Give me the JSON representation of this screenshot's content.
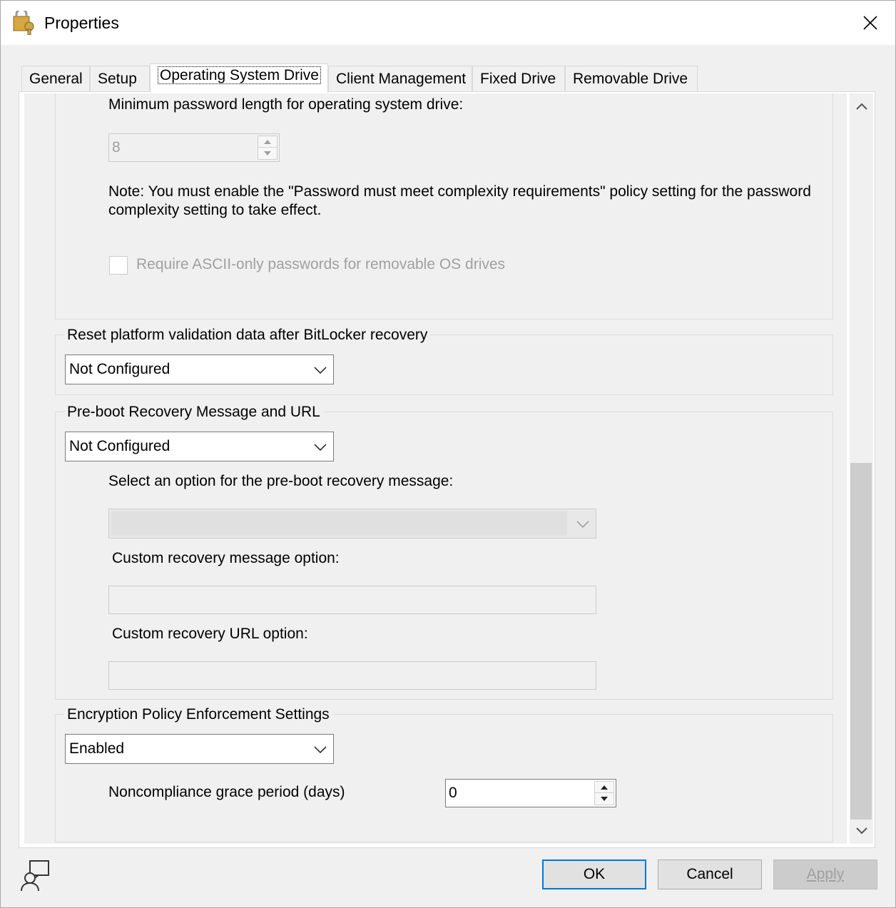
{
  "window": {
    "title": "Properties",
    "app_icon": "key-padlock-icon",
    "close_icon": "close-icon"
  },
  "tabs": [
    {
      "label": "General"
    },
    {
      "label": "Setup"
    },
    {
      "label": "Operating System Drive"
    },
    {
      "label": "Client Management"
    },
    {
      "label": "Fixed Drive"
    },
    {
      "label": "Removable Drive"
    }
  ],
  "active_tab": "Operating System Drive",
  "password_section": {
    "min_length_label": "Minimum password length for operating system drive:",
    "min_length_value": "8",
    "note": "Note: You must enable the \"Password must meet complexity requirements\" policy setting for the password complexity setting to take effect.",
    "note_line1": "Note: You must enable the \"Password must meet complexity requirements\" policy setting for the password",
    "note_line2": "complexity setting to take effect.",
    "ascii_checkbox_label": "Require ASCII-only passwords for removable OS drives",
    "ascii_checked": false
  },
  "reset_platform": {
    "group_label": "Reset platform validation data after BitLocker recovery",
    "selected": "Not Configured"
  },
  "preboot": {
    "group_label": "Pre-boot Recovery Message and URL",
    "selected": "Not Configured",
    "option_label": "Select an option for the pre-boot recovery message:",
    "option_value": "",
    "custom_message_label": "Custom recovery message option:",
    "custom_message_value": "",
    "custom_url_label": "Custom recovery URL option:",
    "custom_url_value": ""
  },
  "encryption_policy": {
    "group_label": "Encryption Policy Enforcement Settings",
    "selected": "Enabled",
    "grace_label": "Noncompliance grace period (days)",
    "grace_value": "0"
  },
  "buttons": {
    "ok": "OK",
    "cancel": "Cancel",
    "apply": "Apply"
  },
  "footer": {
    "help_icon": "user-help-icon"
  }
}
